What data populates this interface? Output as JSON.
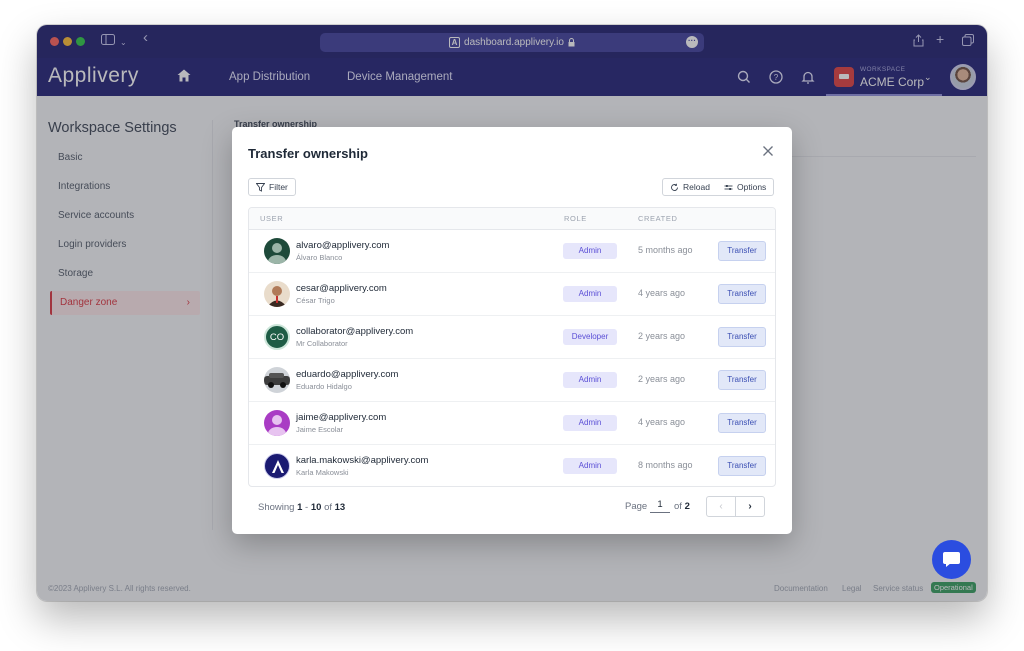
{
  "browser": {
    "url": "dashboard.applivery.io"
  },
  "app": {
    "brand": "Applivery",
    "nav": [
      "App Distribution",
      "Device Management"
    ],
    "workspace_label": "WORKSPACE",
    "workspace_name": "ACME Corp"
  },
  "sidebar": {
    "title": "Workspace Settings",
    "items": [
      {
        "label": "Basic"
      },
      {
        "label": "Integrations"
      },
      {
        "label": "Service accounts"
      },
      {
        "label": "Login providers"
      },
      {
        "label": "Storage"
      },
      {
        "label": "Danger zone",
        "active": true
      }
    ]
  },
  "background": {
    "section_title": "Transfer ownership"
  },
  "modal": {
    "title": "Transfer ownership",
    "filter_label": "Filter",
    "reload_label": "Reload",
    "options_label": "Options",
    "columns": [
      "USER",
      "ROLE",
      "CREATED"
    ],
    "rows": [
      {
        "email": "alvaro@applivery.com",
        "name": "Álvaro Blanco",
        "role": "Admin",
        "created": "5 months ago",
        "action": "Transfer",
        "avatar": "person-dark-green"
      },
      {
        "email": "cesar@applivery.com",
        "name": "César Trigo",
        "role": "Admin",
        "created": "4 years ago",
        "action": "Transfer",
        "avatar": "photo-person"
      },
      {
        "email": "collaborator@applivery.com",
        "name": "Mr Collaborator",
        "role": "Developer",
        "created": "2 years ago",
        "action": "Transfer",
        "avatar": "initials",
        "initials": "CO"
      },
      {
        "email": "eduardo@applivery.com",
        "name": "Eduardo Hidalgo",
        "role": "Admin",
        "created": "2 years ago",
        "action": "Transfer",
        "avatar": "photo-car"
      },
      {
        "email": "jaime@applivery.com",
        "name": "Jaime Escolar",
        "role": "Admin",
        "created": "4 years ago",
        "action": "Transfer",
        "avatar": "person-purple"
      },
      {
        "email": "karla.makowski@applivery.com",
        "name": "Karla Makowski",
        "role": "Admin",
        "created": "8 months ago",
        "action": "Transfer",
        "avatar": "applivery-logo"
      }
    ],
    "showing_prefix": "Showing",
    "showing_from": "1",
    "showing_dash": "-",
    "showing_to": "10",
    "showing_of": "of",
    "showing_total": "13",
    "page_label": "Page",
    "page_current": "1",
    "page_of": "of",
    "page_total": "2"
  },
  "footer": {
    "copyright": "©2023 Applivery S.L. All rights reserved.",
    "links": [
      "Documentation",
      "Legal",
      "Service status"
    ],
    "status_badge": "Operational"
  },
  "colors": {
    "header_bg": "#1b1b72",
    "danger": "#dc2f3a",
    "role_badge_bg": "#e6e6fb",
    "transfer_btn_bg": "#e2e8f8",
    "status_green": "#2f9b5a",
    "chat_blue": "#2b4de0"
  }
}
